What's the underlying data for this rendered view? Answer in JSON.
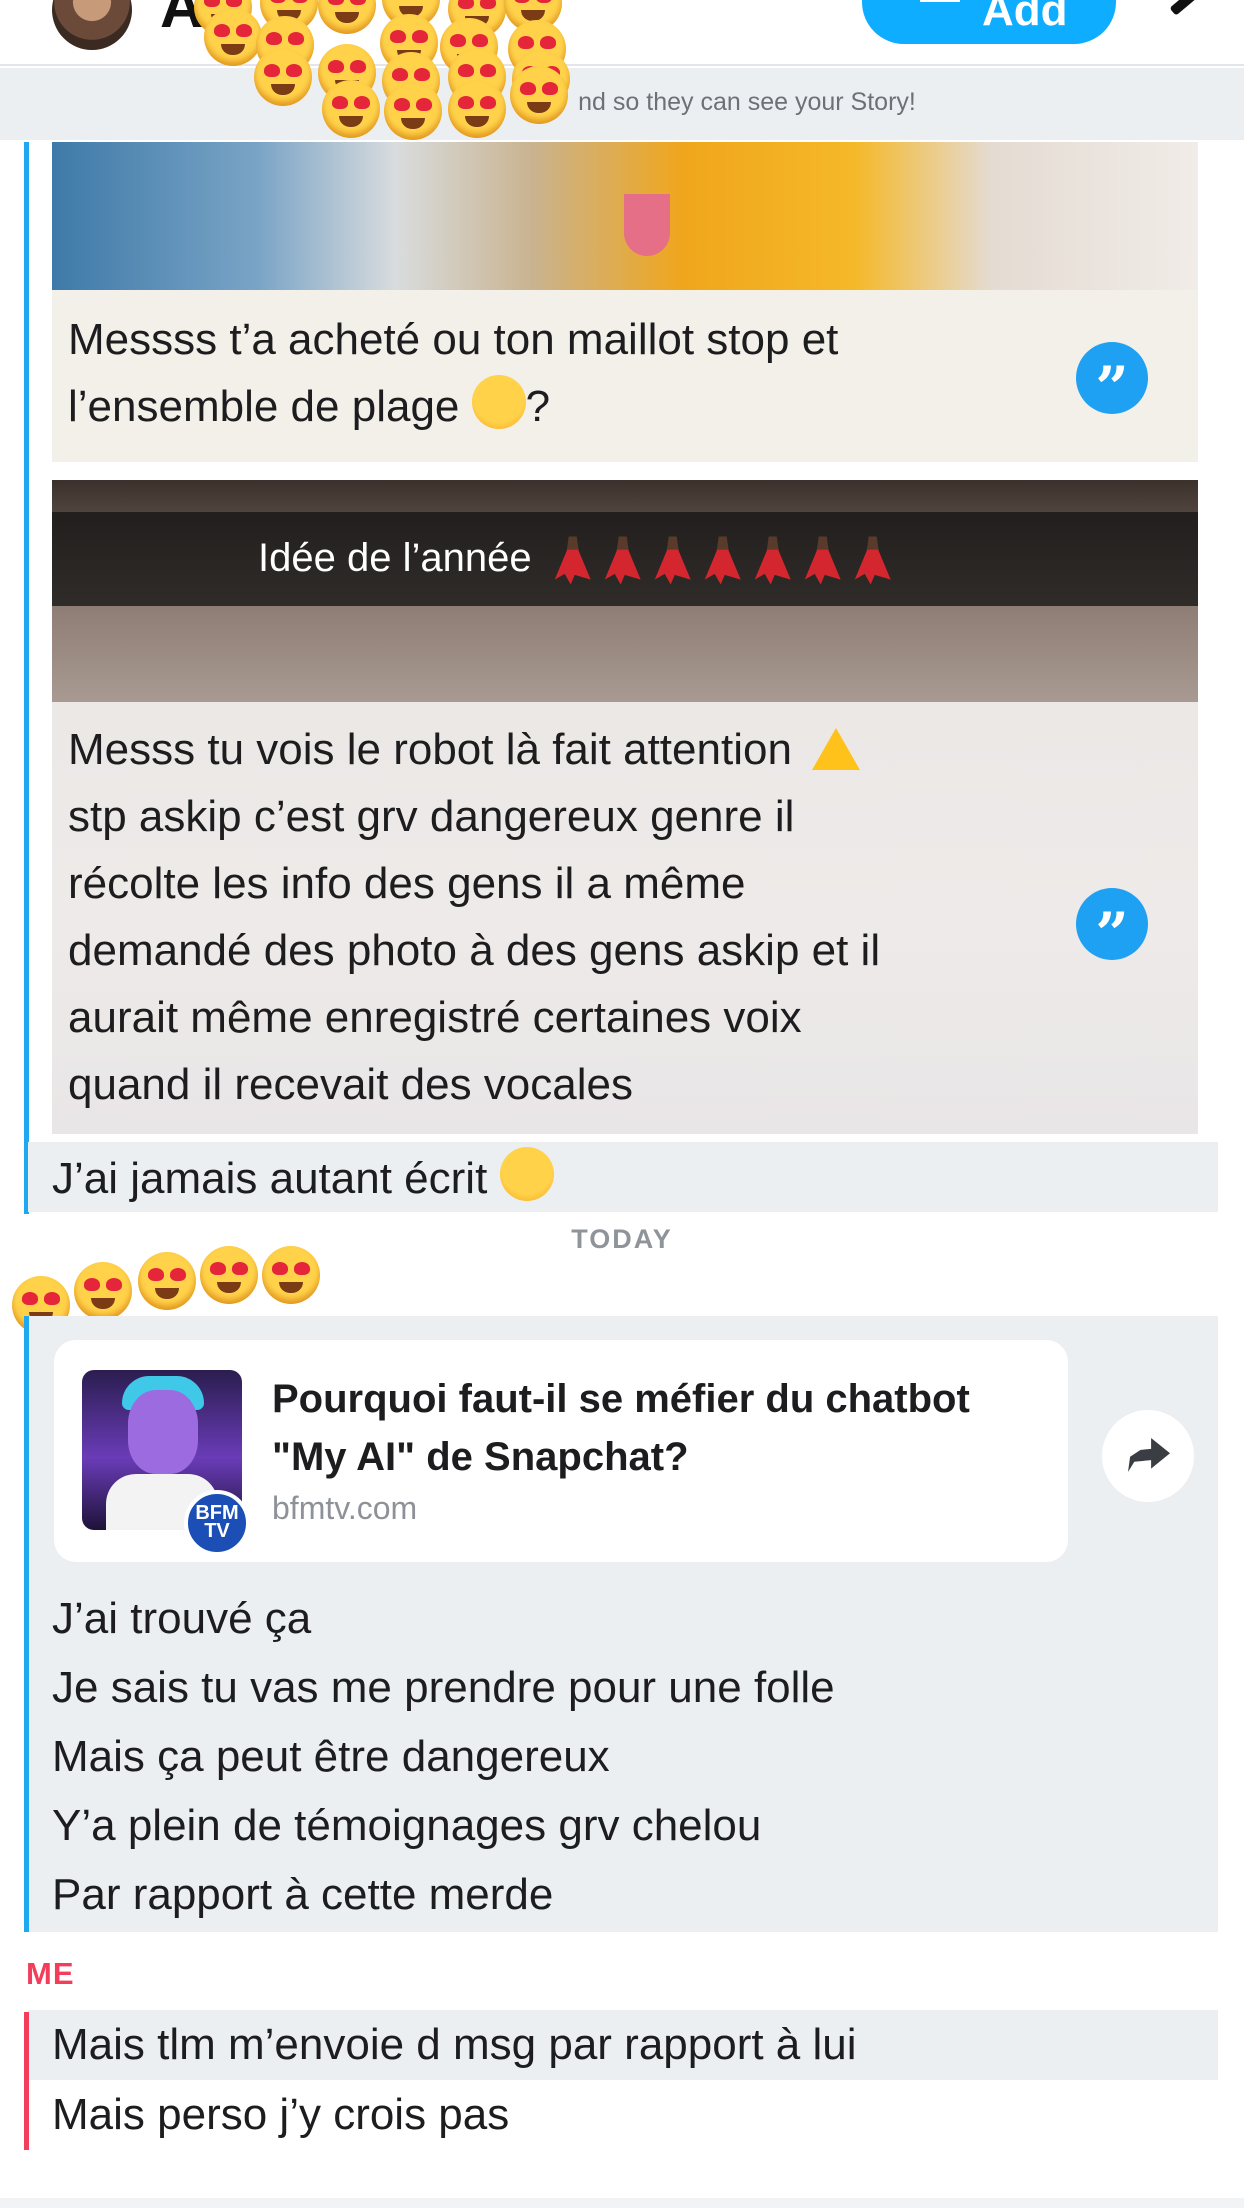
{
  "header": {
    "title_visible_fragment": "A",
    "add_button_label": "Add",
    "notice": "nd so they can see your Story!"
  },
  "story_replies": [
    {
      "text_lines": [
        "Messss t’a acheté ou ton maillot stop et",
        "l’ensemble de plage"
      ],
      "text_suffix": "?",
      "emoji": "pleading-face"
    },
    {
      "caption": "Idée de l’année",
      "caption_emoji_count": 7,
      "text_lines": [
        "Messs tu vois le robot là fait attention",
        "stp askip c’est grv dangereux genre il",
        "récolte les info des gens il a même",
        "demandé des photo à des gens askip et il",
        "aurait même enregistré certaines voix",
        "quand il recevait des vocales"
      ]
    }
  ],
  "friend_message_1": "J’ai jamais autant écrit",
  "day_separator": "TODAY",
  "link_card": {
    "title_lines": [
      "Pourquoi faut-il se méfier du chatbot",
      "\"My AI\" de Snapchat?"
    ],
    "domain": "bfmtv.com",
    "badge": "BFM TV"
  },
  "friend_messages_today": [
    "J’ai trouvé ça",
    "Je sais tu vas me prendre pour une folle",
    "Mais ça peut être dangereux",
    "Y’a plein de témoignages grv chelou",
    "Par rapport à cette merde"
  ],
  "me": {
    "label": "ME",
    "messages": [
      "Mais tlm m’envoie d msg par rapport à lui",
      "Mais perso j’y crois pas"
    ]
  },
  "colors": {
    "accent_blue": "#0fadff",
    "friend_bar": "#1fa8f0",
    "me_color": "#f23d5c",
    "row_gray": "#eceff2"
  },
  "icons": [
    "avatar",
    "add-friend-icon",
    "edit-icon",
    "quote-reply-icon",
    "warning-icon",
    "laughing-emoji",
    "share-icon",
    "heart-eyes-emoji"
  ]
}
